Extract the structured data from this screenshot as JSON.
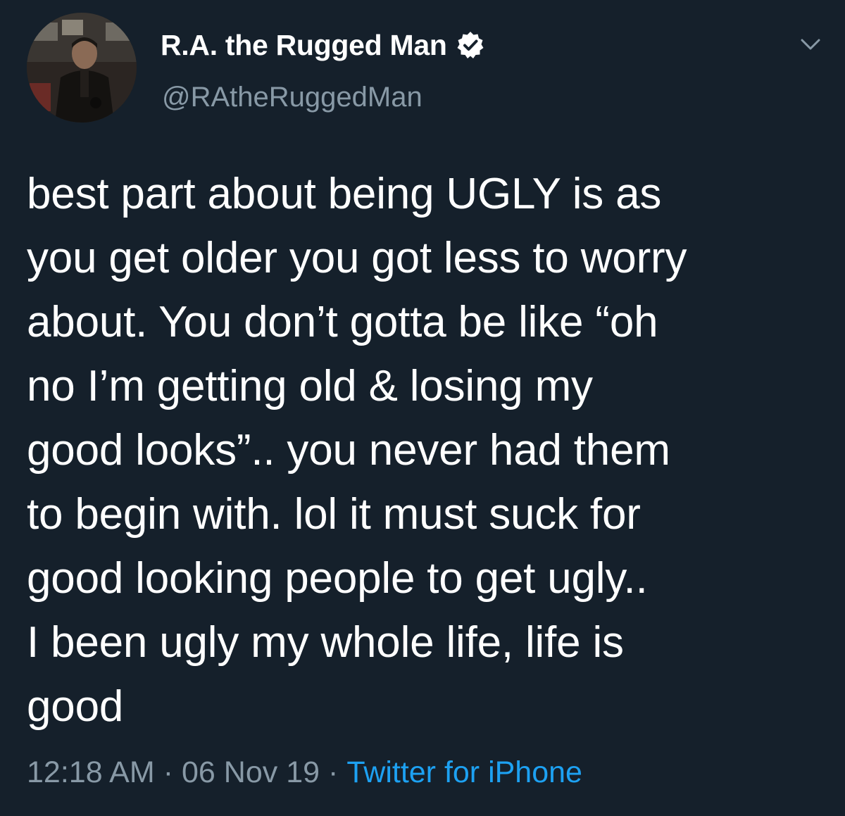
{
  "author": {
    "display_name": "R.A. the Rugged Man",
    "handle": "@RAtheRuggedMan",
    "verified": true,
    "avatar_icon": "user-avatar"
  },
  "tweet": {
    "text": "best part about being UGLY is as\nyou get older you got less to worry\nabout. You don’t gotta be like “oh\nno I’m getting old & losing my\ngood looks”.. you never had them\nto begin with. lol it must suck for\ngood looking people to get ugly..\nI been ugly my whole life, life is\ngood",
    "time": "12:18 AM",
    "date": "06 Nov 19",
    "source": "Twitter for iPhone",
    "separator": "·"
  },
  "icons": {
    "verified": "verified-badge-icon",
    "menu": "chevron-down-icon"
  },
  "colors": {
    "background": "#15202b",
    "text": "#ffffff",
    "secondary": "#8899a6",
    "link": "#1da1f2"
  }
}
